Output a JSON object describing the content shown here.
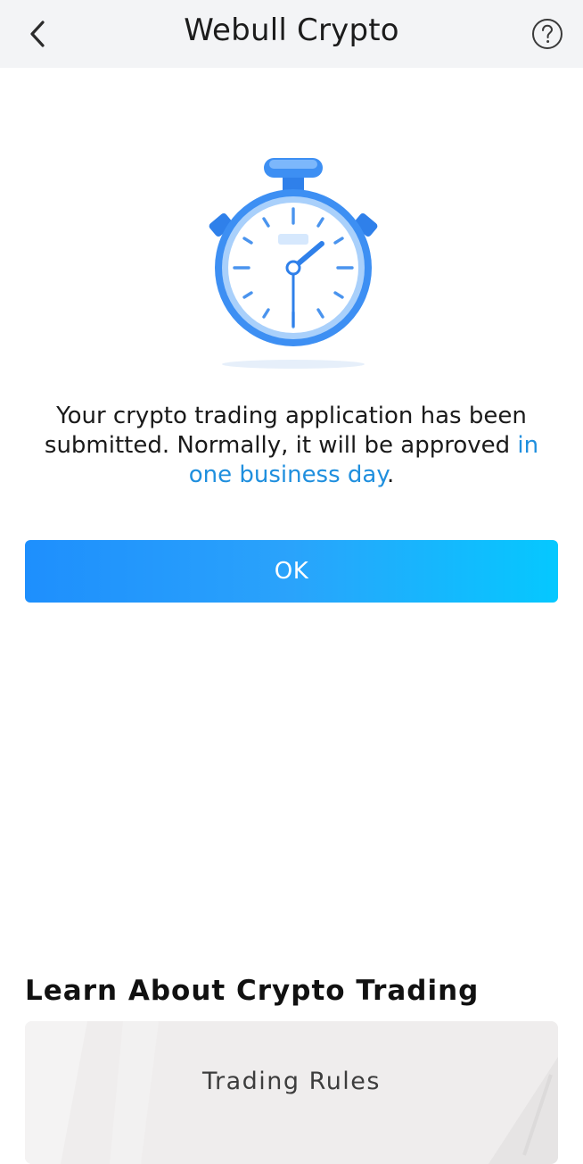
{
  "nav": {
    "title": "Webull Crypto",
    "back_icon": "chevron-left-icon",
    "help_icon": "question-circle-icon"
  },
  "status": {
    "illustration": "stopwatch-icon",
    "message_prefix": "Your crypto trading application has been submitted. Normally, it will be approved ",
    "message_link": "in one business day",
    "message_suffix": "."
  },
  "actions": {
    "ok_label": "OK"
  },
  "learn": {
    "title": "Learn About Crypto Trading",
    "cards": [
      {
        "label": "Trading Rules"
      }
    ]
  },
  "colors": {
    "accent": "#1f8fde",
    "button_gradient_start": "#1e8ffd",
    "button_gradient_end": "#05c8ff",
    "nav_background": "#f3f4f6"
  }
}
